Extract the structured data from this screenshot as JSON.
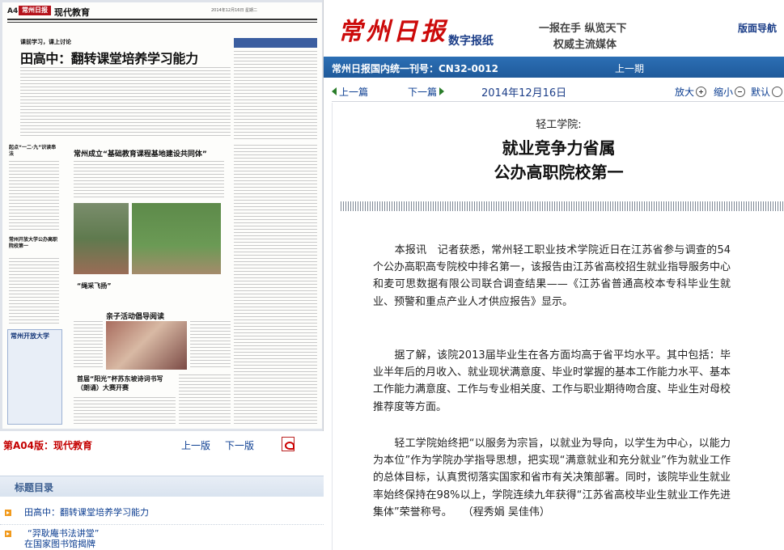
{
  "left": {
    "thumbnail": {
      "page_label": "A4",
      "logo_text": "常州日报",
      "section": "现代教育",
      "date_line": "2014年12月16日 星期二",
      "kicker": "课前学习，课上讨论",
      "headline": "田高中：翻转课堂培养学习能力",
      "sub1": "常州成立“基础教育课程基地建设共同体”",
      "sub2": "“绳采飞扬”",
      "sub3": "亲子活动倡导阅读",
      "sub4": "首届“阳光”杯苏东坡诗词书写（朗诵）大赛开赛",
      "side1": "起点“一二·九”识读串法",
      "side2": "常州开放大学公办高职院校第一",
      "box_title": "常州开放大学"
    },
    "page_bar": {
      "label": "第A04版：现代教育",
      "prev": "上一版",
      "next": "下一版"
    },
    "toc": {
      "title": "标题目录",
      "items": [
        {
          "title": "田高中：翻转课堂培养学习能力"
        },
        {
          "title": "“羿耿庵书法讲堂”",
          "title2": "在国家图书馆揭牌"
        }
      ]
    }
  },
  "right": {
    "masthead": {
      "logo": "常州日报",
      "digital": "数字报纸",
      "slogan1": "一报在手  纵览天下",
      "slogan2": "权威主流媒体",
      "nav": "版面导航"
    },
    "cn_bar": {
      "cn": "常州日报国内统一刊号：CN32-0012",
      "prev": "上一期"
    },
    "toolbar": {
      "prev": "上一篇",
      "next": "下一篇",
      "date": "2014年12月16日",
      "zoom_in": "放大",
      "zoom_out": "缩小",
      "default": "默认"
    },
    "article": {
      "kicker": "轻工学院:",
      "headline_line1": "就业竞争力省属",
      "headline_line2": "公办高职院校第一",
      "paragraphs": [
        "本报讯　记者获悉，常州轻工职业技术学院近日在江苏省参与调查的54个公办高职高专院校中排名第一，该报告由江苏省高校招生就业指导服务中心和麦可思数据有限公司联合调查结果——《江苏省普通高校本专科毕业生就业、预警和重点产业人才供应报告》显示。",
        "据了解，该院2013届毕业生在各方面均高于省平均水平。其中包括：毕业半年后的月收入、就业现状满意度、毕业时掌握的基本工作能力水平、基本工作能力满意度、工作与专业相关度、工作与职业期待吻合度、毕业生对母校推荐度等方面。",
        "轻工学院始终把“以服务为宗旨，以就业为导向，以学生为中心，以能力为本位”作为学院办学指导思想，把实现“满意就业和充分就业”作为就业工作的总体目标，认真贯彻落实国家和省市有关决策部署。同时，该院毕业生就业率始终保持在98%以上，学院连续九年获得“江苏省高校毕业生就业工作先进集体”荣誉称号。　　（程秀娟  吴佳伟）"
      ]
    }
  },
  "colors": {
    "brand_red": "#cc0a0a",
    "nav_blue": "#1c3e88",
    "bar_blue": "#2c6fb5",
    "link_blue": "#0b3d91",
    "page_label_red": "#c40000",
    "bullet_orange": "#f19a1c"
  }
}
